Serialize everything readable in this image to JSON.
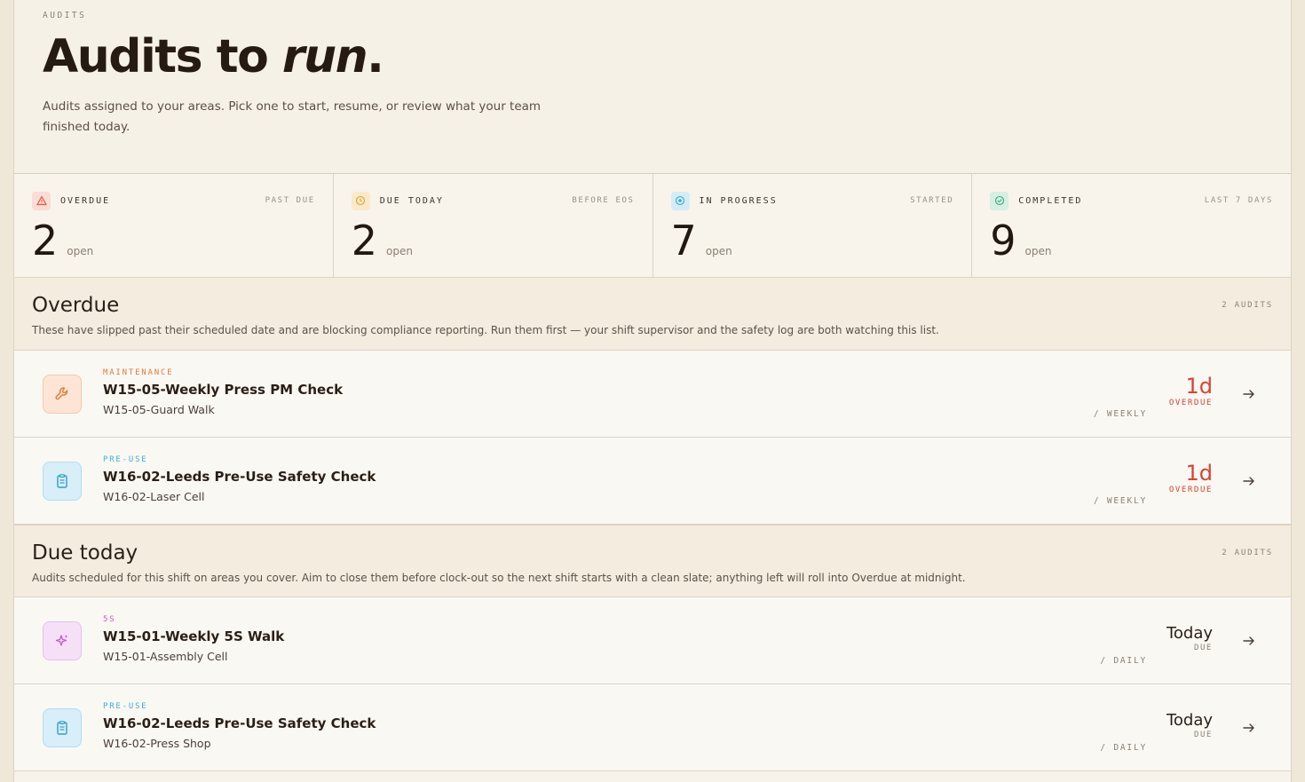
{
  "header": {
    "eyebrow": "AUDITS",
    "title_main": "Audits to ",
    "title_em": "run",
    "title_end": ".",
    "subtitle": "Audits assigned to your areas. Pick one to start, resume, or review what your team finished today."
  },
  "stats": [
    {
      "label": "OVERDUE",
      "note": "PAST DUE",
      "value": "2",
      "unit": "open",
      "icon": "warning-triangle-icon",
      "color": "#e25845",
      "bg": "#fbdcd6"
    },
    {
      "label": "DUE TODAY",
      "note": "BEFORE EOS",
      "value": "2",
      "unit": "open",
      "icon": "clock-icon",
      "color": "#e2a23a",
      "bg": "#fbe9c7"
    },
    {
      "label": "IN PROGRESS",
      "note": "STARTED",
      "value": "7",
      "unit": "open",
      "icon": "progress-circle-icon",
      "color": "#3aa6d8",
      "bg": "#d4ecf7"
    },
    {
      "label": "COMPLETED",
      "note": "LAST 7 DAYS",
      "value": "9",
      "unit": "open",
      "icon": "check-circle-icon",
      "color": "#3bab7a",
      "bg": "#d5efe2"
    }
  ],
  "sections": [
    {
      "title": "Overdue",
      "count": "2 AUDITS",
      "description": "These have slipped past their scheduled date and are blocking compliance reporting. Run them first — your shift supervisor and the safety log are both watching this list.",
      "rows": [
        {
          "category": "MAINTENANCE",
          "cat_color": "#e47a3a",
          "name": "W15-05-Weekly Press PM Check",
          "location": "W15-05-Guard Walk",
          "frequency": "/ WEEKLY",
          "due_value": "1d",
          "due_label": "OVERDUE",
          "icon": "wrench-icon"
        },
        {
          "category": "PRE-USE",
          "cat_color": "#3ab0dc",
          "name": "W16-02-Leeds Pre-Use Safety Check",
          "location": "W16-02-Laser Cell",
          "frequency": "/ WEEKLY",
          "due_value": "1d",
          "due_label": "OVERDUE",
          "icon": "clipboard-icon"
        }
      ]
    },
    {
      "title": "Due today",
      "count": "2 AUDITS",
      "description": "Audits scheduled for this shift on areas you cover. Aim to close them before clock-out so the next shift starts with a clean slate; anything left will roll into Overdue at midnight.",
      "rows": [
        {
          "category": "5S",
          "cat_color": "#c45ad0",
          "name": "W15-01-Weekly 5S Walk",
          "location": "W15-01-Assembly Cell",
          "frequency": "/ DAILY",
          "due_value": "Today",
          "due_label": "DUE",
          "icon": "sparkle-icon"
        },
        {
          "category": "PRE-USE",
          "cat_color": "#3ab0dc",
          "name": "W16-02-Leeds Pre-Use Safety Check",
          "location": "W16-02-Press Shop",
          "frequency": "/ DAILY",
          "due_value": "Today",
          "due_label": "DUE",
          "icon": "clipboard-icon"
        }
      ]
    }
  ]
}
